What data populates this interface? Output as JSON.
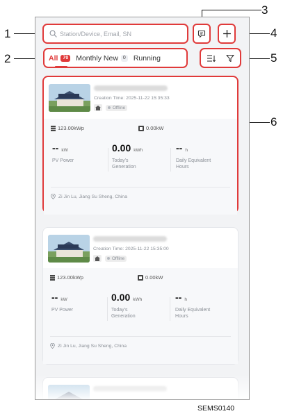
{
  "search": {
    "placeholder": "Station/Device, Email, SN",
    "icon": "search-icon"
  },
  "header": {
    "ticket_icon": "ticket-icon",
    "add_icon": "plus-icon"
  },
  "tabs": [
    {
      "label": "All",
      "count": "70"
    },
    {
      "label": "Monthly New",
      "count": "0"
    },
    {
      "label": "Running"
    }
  ],
  "toolbar": {
    "sort_icon": "sort-icon",
    "filter_icon": "filter-icon"
  },
  "stations": [
    {
      "creation_time": "Creation Time: 2025-11-22 15:35:33",
      "status": "Offline",
      "capacity": "123.00kWp",
      "power": "0.00kW",
      "pv_power": {
        "value": "--",
        "unit": "kW",
        "label": "PV Power"
      },
      "generation": {
        "value": "0.00",
        "unit": "kWh",
        "label": "Today's Generation"
      },
      "equivalent": {
        "value": "--",
        "unit": "h",
        "label": "Daily Equivalent Hours"
      },
      "address": "Zi Jin Lu, Jiang Su Sheng, China"
    },
    {
      "creation_time": "Creation Time: 2025-11-22 15:35:00",
      "status": "Offline",
      "capacity": "123.00kWp",
      "power": "0.00kW",
      "pv_power": {
        "value": "--",
        "unit": "kW",
        "label": "PV Power"
      },
      "generation": {
        "value": "0.00",
        "unit": "kWh",
        "label": "Today's Generation"
      },
      "equivalent": {
        "value": "--",
        "unit": "h",
        "label": "Daily Equivalent Hours"
      },
      "address": "Zi Jin Lu, Jiang Su Sheng, China"
    }
  ],
  "callouts": {
    "c1": "1",
    "c2": "2",
    "c3": "3",
    "c4": "4",
    "c5": "5",
    "c6": "6"
  },
  "footer": {
    "code": "SEMS0140"
  },
  "colors": {
    "accent": "#e03a3a",
    "background": "#f2f3f5"
  }
}
